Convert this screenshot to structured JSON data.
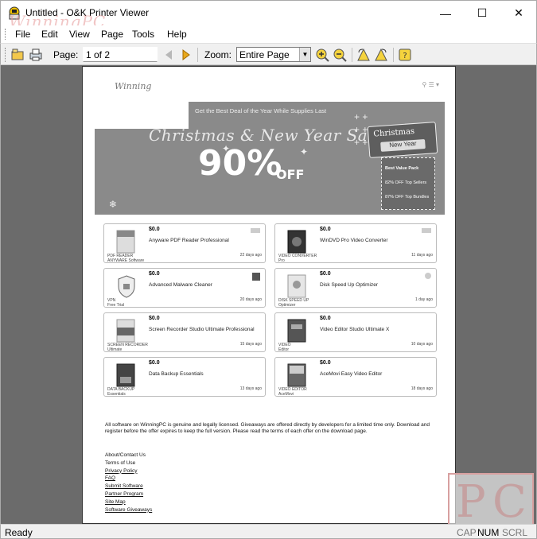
{
  "window": {
    "title": "Untitled - O&K Printer Viewer",
    "watermark_top": "WinningPC",
    "controls": {
      "minimize": "—",
      "maximize": "☐",
      "close": "✕"
    }
  },
  "menu": [
    "File",
    "Edit",
    "View",
    "Page",
    "Tools",
    "Help"
  ],
  "toolbar": {
    "page_label": "Page:",
    "page_value": "1 of 2",
    "zoom_label": "Zoom:",
    "zoom_value": "Entire Page",
    "icons": [
      "open-icon",
      "print-icon",
      "prev-page-icon",
      "next-page-icon",
      "zoom-in-icon",
      "zoom-out-icon",
      "rotate-left-icon",
      "rotate-right-icon",
      "help-icon"
    ]
  },
  "document": {
    "logo": "Winning",
    "nav": "⚲  ☰ ▾",
    "banner": {
      "tagline": "Get the Best Deal of the Year While Supplies Last",
      "headline": "Christmas & New Year Sale",
      "discount": "90%",
      "off": "OFF",
      "badge_title": "Christmas",
      "badge_sub": "New Year",
      "tag_lines": [
        "Best Value Pack",
        "82% OFF Top Sellers",
        "87% OFF Top Bundles"
      ]
    },
    "products": [
      {
        "price": "$0.0",
        "name": "Anyware PDF Reader Professional",
        "left": [
          "PDF READER",
          "ANYWARE Software"
        ],
        "right": "22 days ago"
      },
      {
        "price": "$0.0",
        "name": "WinDVD Pro Video Converter",
        "left": [
          "VIDEO CONVERTER",
          "Pro"
        ],
        "right": "11 days ago"
      },
      {
        "price": "$0.0",
        "name": "Advanced Malware Cleaner",
        "left": [
          "VPN",
          "Free Trial"
        ],
        "right": "20 days ago"
      },
      {
        "price": "$0.0",
        "name": "Disk Speed Up Optimizer",
        "left": [
          "DISK SPEED UP",
          "Optimizer"
        ],
        "right": "1 day ago"
      },
      {
        "price": "$0.0",
        "name": "Screen Recorder Studio Ultimate Professional",
        "left": [
          "SCREEN RECORDER",
          "Ultimate"
        ],
        "right": "15 days ago"
      },
      {
        "price": "$0.0",
        "name": "Video Editor Studio Ultimate X",
        "left": [
          "VIDEO",
          "Editor"
        ],
        "right": "10 days ago"
      },
      {
        "price": "$0.0",
        "name": "Data Backup Essentials",
        "left": [
          "DATA BACKUP",
          "Essentials"
        ],
        "right": "13 days ago"
      },
      {
        "price": "$0.0",
        "name": "AceMovi Easy Video Editor",
        "left": [
          "VIDEO EDITOR",
          "AceMovi"
        ],
        "right": "18 days ago"
      }
    ],
    "paragraph": "All software on WinningPC is genuine and legally licensed. Giveaways are offered directly by developers for a limited time only. Download and register before the offer expires to keep the full version. Please read the terms of each offer on the download page.",
    "links": [
      "About/Contact Us",
      "Terms of Use",
      "Privacy Policy",
      "FAQ",
      "Submit Software",
      "Partner Program",
      "Site Map",
      "Software Giveaways"
    ]
  },
  "status": {
    "text": "Ready",
    "indicators": [
      "CAP",
      "NUM",
      "SCRL"
    ]
  },
  "colors": {
    "viewport_bg": "#6b6b6b",
    "banner_bg": "#8a8a8a",
    "watermark": "#d8a0a0"
  }
}
